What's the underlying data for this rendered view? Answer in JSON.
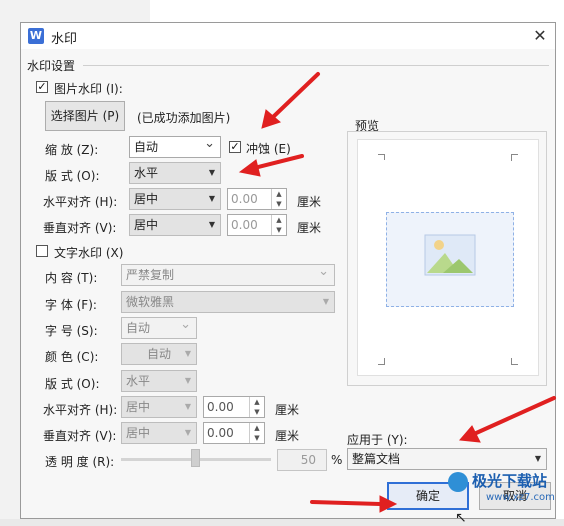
{
  "window": {
    "title": "水印",
    "logo": "W"
  },
  "section_title": "水印设置",
  "image_watermark": {
    "checkbox_label": "图片水印 (I):",
    "checked": true,
    "select_button": "选择图片 (P)",
    "status_text": "(已成功添加图片)",
    "scale_label": "缩    放 (Z):",
    "scale_value": "自动",
    "washout_label": "冲蚀 (E)",
    "washout_checked": true,
    "layout_label": "版    式 (O):",
    "layout_value": "水平",
    "halign_label": "水平对齐 (H):",
    "halign_value": "居中",
    "halign_offset": "0.00",
    "valign_label": "垂直对齐 (V):",
    "valign_value": "居中",
    "valign_offset": "0.00",
    "unit": "厘米"
  },
  "text_watermark": {
    "checkbox_label": "文字水印 (X)",
    "checked": false,
    "content_label": "内    容 (T):",
    "content_value": "严禁复制",
    "font_label": "字    体 (F):",
    "font_value": "微软雅黑",
    "size_label": "字    号 (S):",
    "size_value": "自动",
    "color_label": "颜    色 (C):",
    "color_value": "自动",
    "layout_label": "版    式 (O):",
    "layout_value": "水平",
    "halign_label": "水平对齐 (H):",
    "halign_value": "居中",
    "halign_offset": "0.00",
    "valign_label": "垂直对齐 (V):",
    "valign_value": "居中",
    "valign_offset": "0.00",
    "unit": "厘米",
    "transparency_label": "透 明 度 (R):",
    "transparency_value": "50",
    "transparency_unit": "%"
  },
  "preview": {
    "label": "预览"
  },
  "apply_to": {
    "label": "应用于 (Y):",
    "value": "整篇文档"
  },
  "buttons": {
    "ok": "确定",
    "cancel": "取消"
  },
  "watermark_logo": {
    "text": "极光下载站",
    "url": "www.xz7.com"
  },
  "colors": {
    "accent": "#2f6fd6",
    "annotation_arrow": "#e02020"
  }
}
